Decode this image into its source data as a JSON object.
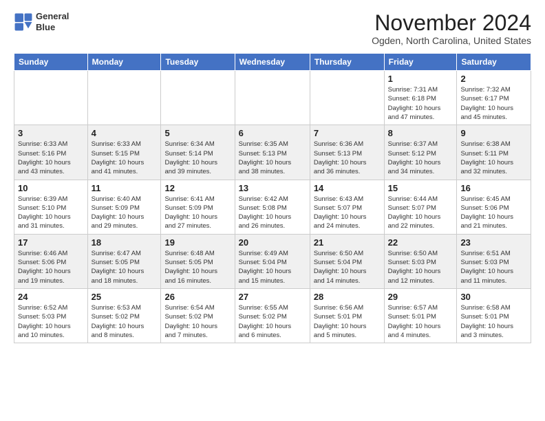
{
  "logo": {
    "line1": "General",
    "line2": "Blue"
  },
  "header": {
    "title": "November 2024",
    "subtitle": "Ogden, North Carolina, United States"
  },
  "weekdays": [
    "Sunday",
    "Monday",
    "Tuesday",
    "Wednesday",
    "Thursday",
    "Friday",
    "Saturday"
  ],
  "weeks": [
    [
      {
        "day": "",
        "detail": ""
      },
      {
        "day": "",
        "detail": ""
      },
      {
        "day": "",
        "detail": ""
      },
      {
        "day": "",
        "detail": ""
      },
      {
        "day": "",
        "detail": ""
      },
      {
        "day": "1",
        "detail": "Sunrise: 7:31 AM\nSunset: 6:18 PM\nDaylight: 10 hours\nand 47 minutes."
      },
      {
        "day": "2",
        "detail": "Sunrise: 7:32 AM\nSunset: 6:17 PM\nDaylight: 10 hours\nand 45 minutes."
      }
    ],
    [
      {
        "day": "3",
        "detail": "Sunrise: 6:33 AM\nSunset: 5:16 PM\nDaylight: 10 hours\nand 43 minutes."
      },
      {
        "day": "4",
        "detail": "Sunrise: 6:33 AM\nSunset: 5:15 PM\nDaylight: 10 hours\nand 41 minutes."
      },
      {
        "day": "5",
        "detail": "Sunrise: 6:34 AM\nSunset: 5:14 PM\nDaylight: 10 hours\nand 39 minutes."
      },
      {
        "day": "6",
        "detail": "Sunrise: 6:35 AM\nSunset: 5:13 PM\nDaylight: 10 hours\nand 38 minutes."
      },
      {
        "day": "7",
        "detail": "Sunrise: 6:36 AM\nSunset: 5:13 PM\nDaylight: 10 hours\nand 36 minutes."
      },
      {
        "day": "8",
        "detail": "Sunrise: 6:37 AM\nSunset: 5:12 PM\nDaylight: 10 hours\nand 34 minutes."
      },
      {
        "day": "9",
        "detail": "Sunrise: 6:38 AM\nSunset: 5:11 PM\nDaylight: 10 hours\nand 32 minutes."
      }
    ],
    [
      {
        "day": "10",
        "detail": "Sunrise: 6:39 AM\nSunset: 5:10 PM\nDaylight: 10 hours\nand 31 minutes."
      },
      {
        "day": "11",
        "detail": "Sunrise: 6:40 AM\nSunset: 5:09 PM\nDaylight: 10 hours\nand 29 minutes."
      },
      {
        "day": "12",
        "detail": "Sunrise: 6:41 AM\nSunset: 5:09 PM\nDaylight: 10 hours\nand 27 minutes."
      },
      {
        "day": "13",
        "detail": "Sunrise: 6:42 AM\nSunset: 5:08 PM\nDaylight: 10 hours\nand 26 minutes."
      },
      {
        "day": "14",
        "detail": "Sunrise: 6:43 AM\nSunset: 5:07 PM\nDaylight: 10 hours\nand 24 minutes."
      },
      {
        "day": "15",
        "detail": "Sunrise: 6:44 AM\nSunset: 5:07 PM\nDaylight: 10 hours\nand 22 minutes."
      },
      {
        "day": "16",
        "detail": "Sunrise: 6:45 AM\nSunset: 5:06 PM\nDaylight: 10 hours\nand 21 minutes."
      }
    ],
    [
      {
        "day": "17",
        "detail": "Sunrise: 6:46 AM\nSunset: 5:06 PM\nDaylight: 10 hours\nand 19 minutes."
      },
      {
        "day": "18",
        "detail": "Sunrise: 6:47 AM\nSunset: 5:05 PM\nDaylight: 10 hours\nand 18 minutes."
      },
      {
        "day": "19",
        "detail": "Sunrise: 6:48 AM\nSunset: 5:05 PM\nDaylight: 10 hours\nand 16 minutes."
      },
      {
        "day": "20",
        "detail": "Sunrise: 6:49 AM\nSunset: 5:04 PM\nDaylight: 10 hours\nand 15 minutes."
      },
      {
        "day": "21",
        "detail": "Sunrise: 6:50 AM\nSunset: 5:04 PM\nDaylight: 10 hours\nand 14 minutes."
      },
      {
        "day": "22",
        "detail": "Sunrise: 6:50 AM\nSunset: 5:03 PM\nDaylight: 10 hours\nand 12 minutes."
      },
      {
        "day": "23",
        "detail": "Sunrise: 6:51 AM\nSunset: 5:03 PM\nDaylight: 10 hours\nand 11 minutes."
      }
    ],
    [
      {
        "day": "24",
        "detail": "Sunrise: 6:52 AM\nSunset: 5:03 PM\nDaylight: 10 hours\nand 10 minutes."
      },
      {
        "day": "25",
        "detail": "Sunrise: 6:53 AM\nSunset: 5:02 PM\nDaylight: 10 hours\nand 8 minutes."
      },
      {
        "day": "26",
        "detail": "Sunrise: 6:54 AM\nSunset: 5:02 PM\nDaylight: 10 hours\nand 7 minutes."
      },
      {
        "day": "27",
        "detail": "Sunrise: 6:55 AM\nSunset: 5:02 PM\nDaylight: 10 hours\nand 6 minutes."
      },
      {
        "day": "28",
        "detail": "Sunrise: 6:56 AM\nSunset: 5:01 PM\nDaylight: 10 hours\nand 5 minutes."
      },
      {
        "day": "29",
        "detail": "Sunrise: 6:57 AM\nSunset: 5:01 PM\nDaylight: 10 hours\nand 4 minutes."
      },
      {
        "day": "30",
        "detail": "Sunrise: 6:58 AM\nSunset: 5:01 PM\nDaylight: 10 hours\nand 3 minutes."
      }
    ]
  ],
  "colors": {
    "header_bg": "#4472C4",
    "header_text": "#ffffff",
    "accent": "#4472C4"
  }
}
